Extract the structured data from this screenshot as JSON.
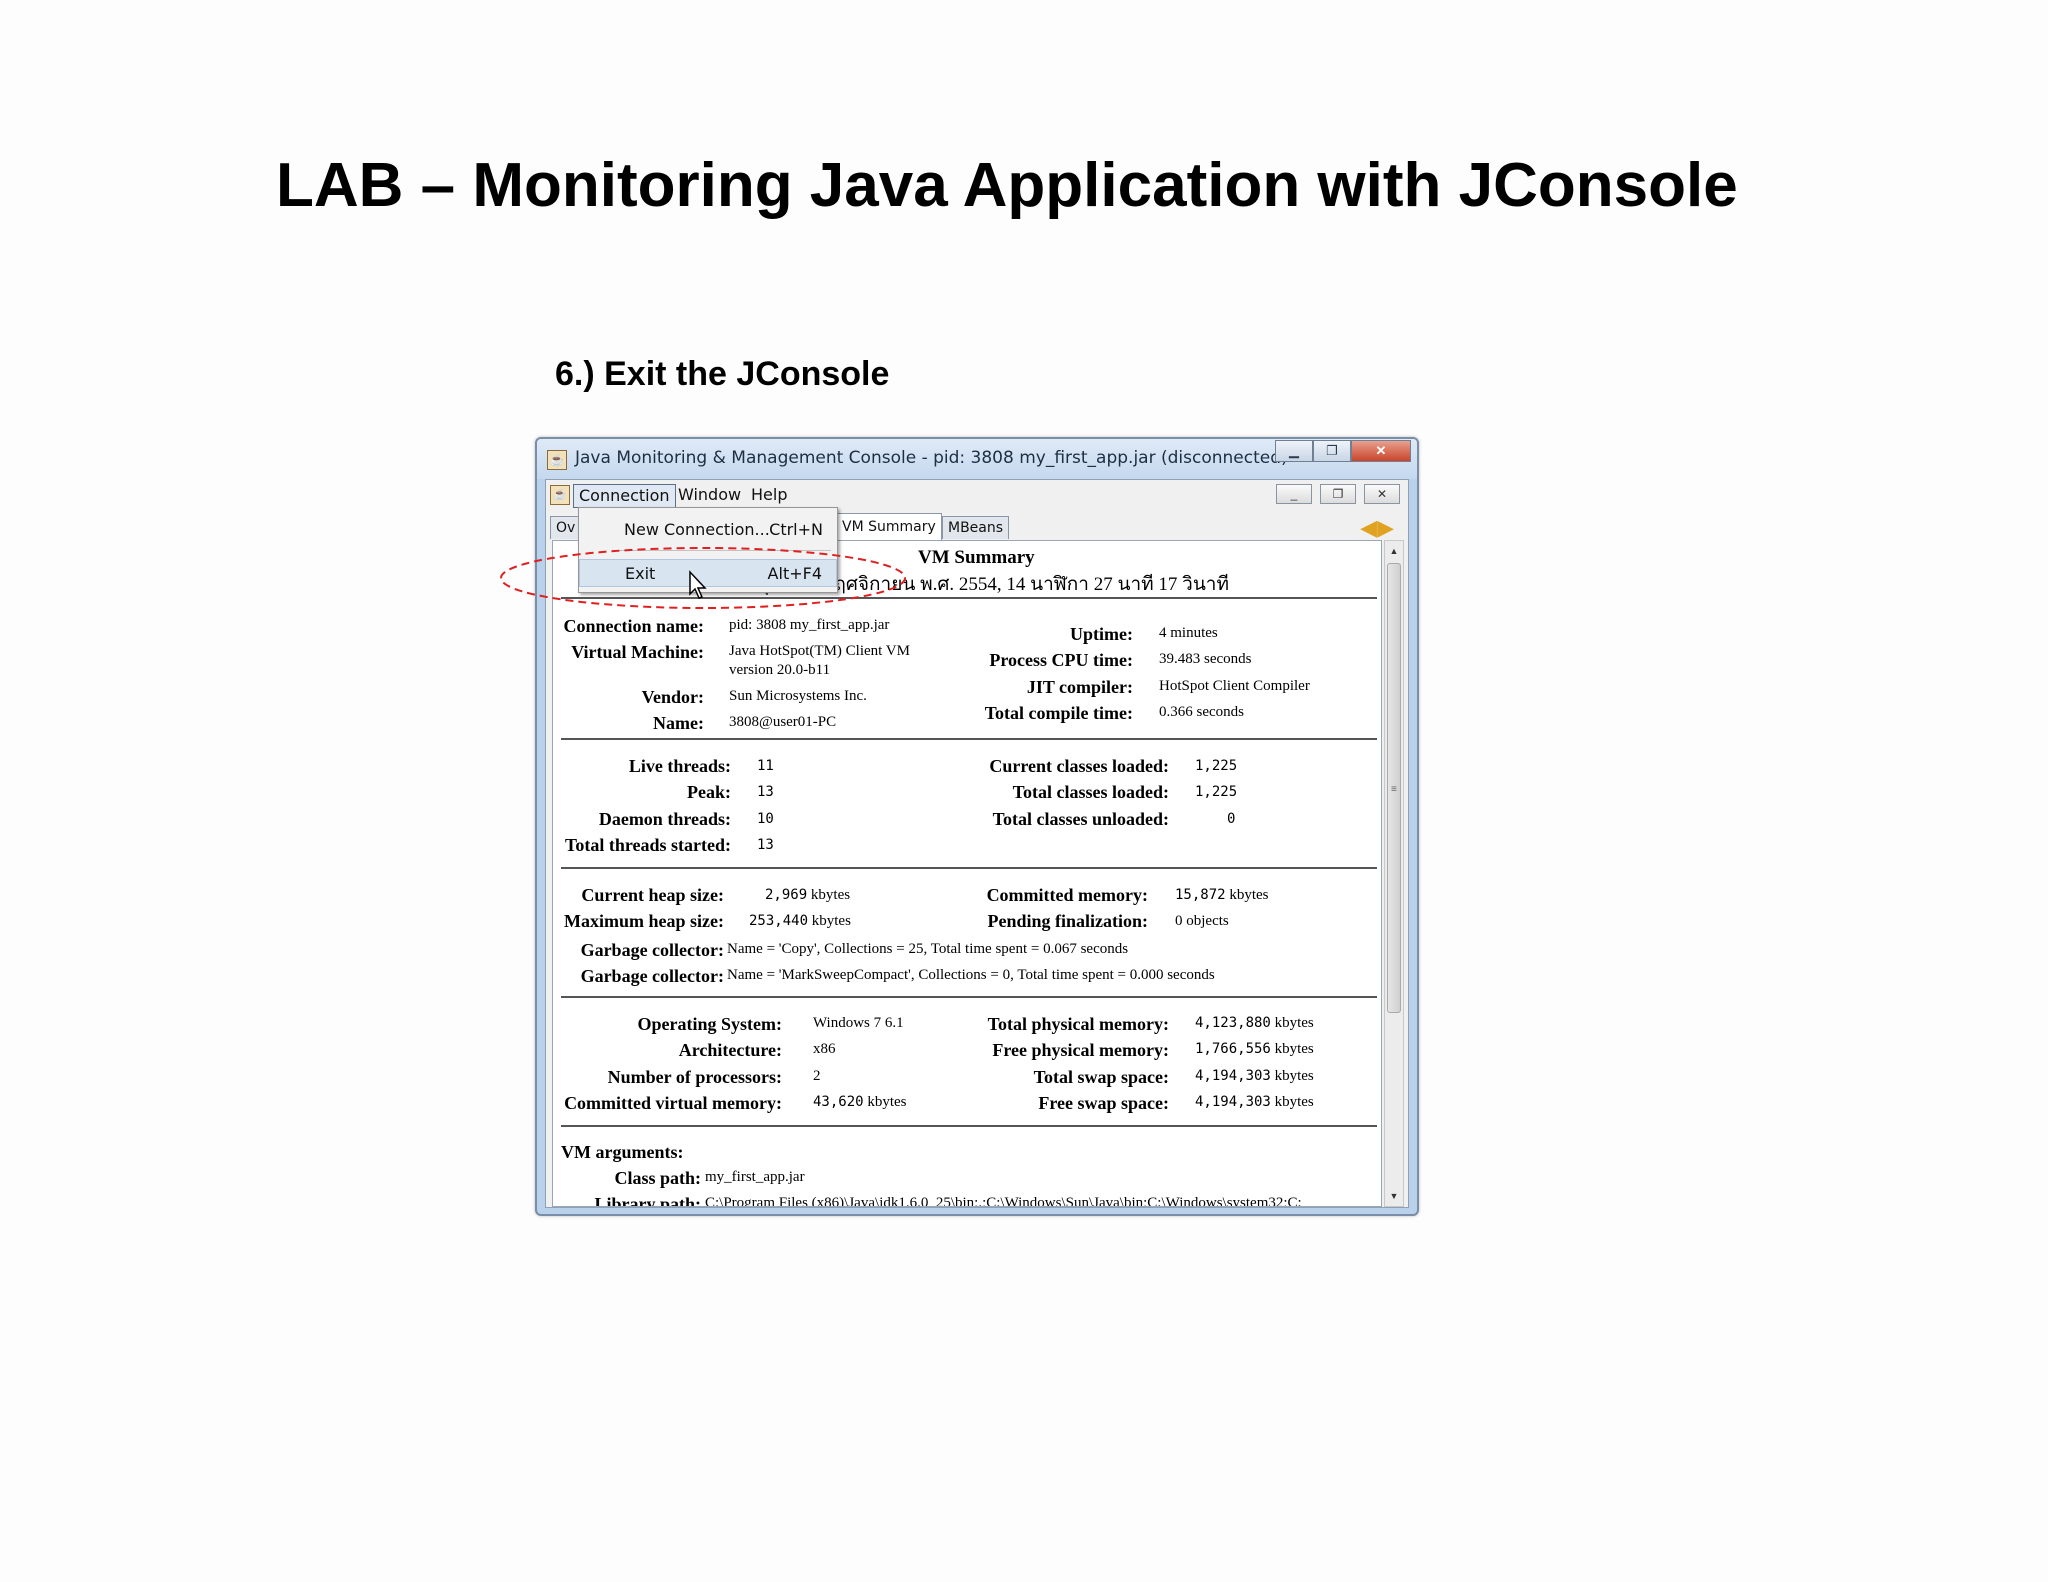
{
  "slide": {
    "title": "LAB – Monitoring Java Application with JConsole",
    "step": "6.) Exit the JConsole"
  },
  "window": {
    "title": "Java Monitoring & Management Console - pid: 3808 my_first_app.jar (disconnected)",
    "menu": [
      "Connection",
      "Window",
      "Help"
    ],
    "tabs": [
      "Ov",
      "VM Summary",
      "MBeans"
    ],
    "dropdown": {
      "items": [
        {
          "label": "New Connection...",
          "accel": "Ctrl+N"
        },
        {
          "label": "Exit",
          "accel": "Alt+F4"
        }
      ]
    }
  },
  "summary": {
    "title": "VM Summary",
    "date": "วันพุธที่ 22 พฤศจิกายน พ.ศ. 2554, 14 นาฬิกา 27 นาที 17 วินาที",
    "connection_name_label": "Connection name:",
    "connection_name": "pid: 3808 my_first_app.jar",
    "virtual_machine_label": "Virtual Machine:",
    "virtual_machine": "Java HotSpot(TM) Client VM",
    "virtual_machine_version": "version 20.0-b11",
    "vendor_label": "Vendor:",
    "vendor": "Sun Microsystems Inc.",
    "name_label": "Name:",
    "name": "3808@user01-PC",
    "uptime_label": "Uptime:",
    "uptime": "4 minutes",
    "cpu_time_label": "Process CPU time:",
    "cpu_time": "39.483 seconds",
    "jit_label": "JIT compiler:",
    "jit": "HotSpot Client Compiler",
    "compile_time_label": "Total compile time:",
    "compile_time": "0.366 seconds",
    "live_threads_label": "Live threads:",
    "live_threads": "11",
    "peak_label": "Peak:",
    "peak": "13",
    "daemon_threads_label": "Daemon threads:",
    "daemon_threads": "10",
    "total_threads_label": "Total threads started:",
    "total_threads": "13",
    "classes_loaded_label": "Current classes loaded:",
    "classes_loaded": "1,225",
    "total_classes_loaded_label": "Total classes loaded:",
    "total_classes_loaded": "1,225",
    "classes_unloaded_label": "Total classes unloaded:",
    "classes_unloaded": "0",
    "heap_size_label": "Current heap size:",
    "heap_size": "2,969",
    "max_heap_label": "Maximum heap size:",
    "max_heap": "253,440",
    "committed_memory_label": "Committed memory:",
    "committed_memory": "15,872",
    "pending_label": "Pending finalization:",
    "pending": "0 objects",
    "kbytes": "kbytes",
    "gc_label": "Garbage collector:",
    "gc1": "Name = 'Copy', Collections = 25, Total time spent = 0.067 seconds",
    "gc2": "Name = 'MarkSweepCompact', Collections = 0, Total time spent = 0.000 seconds",
    "os_label": "Operating System:",
    "os": "Windows 7 6.1",
    "arch_label": "Architecture:",
    "arch": "x86",
    "processors_label": "Number of processors:",
    "processors": "2",
    "virtual_memory_label": "Committed virtual memory:",
    "virtual_memory": "43,620",
    "phys_mem_label": "Total physical memory:",
    "phys_mem": "4,123,880",
    "free_phys_label": "Free physical memory:",
    "free_phys": "1,766,556",
    "swap_label": "Total swap space:",
    "swap": "4,194,303",
    "free_swap_label": "Free swap space:",
    "free_swap": "4,194,303",
    "vm_args_label": "VM arguments:",
    "class_path_label": "Class path:",
    "class_path": "my_first_app.jar",
    "library_path_label": "Library path:",
    "library_path": "C:\\Program Files (x86)\\Java\\jdk1.6.0_25\\bin;.;C:\\Windows\\Sun\\Java\\bin;C:\\Windows\\system32;C:"
  },
  "colors": {
    "annotation": "#e02020",
    "title_bar": "#c4d8ee",
    "close_button": "#c9452b"
  }
}
